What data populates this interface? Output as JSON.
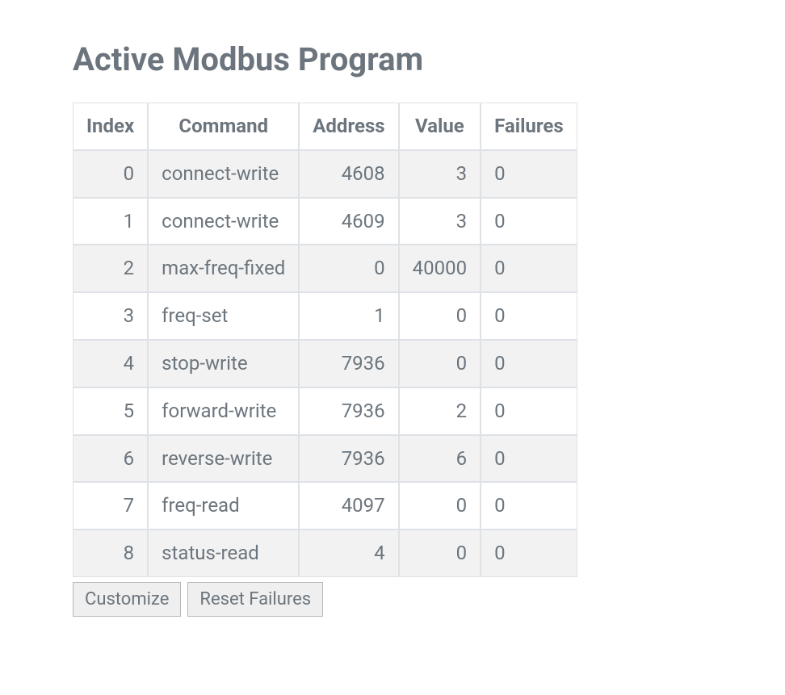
{
  "title": "Active Modbus Program",
  "columns": [
    "Index",
    "Command",
    "Address",
    "Value",
    "Failures"
  ],
  "rows": [
    {
      "index": "0",
      "command": "connect-write",
      "address": "4608",
      "value": "3",
      "failures": "0"
    },
    {
      "index": "1",
      "command": "connect-write",
      "address": "4609",
      "value": "3",
      "failures": "0"
    },
    {
      "index": "2",
      "command": "max-freq-fixed",
      "address": "0",
      "value": "40000",
      "failures": "0"
    },
    {
      "index": "3",
      "command": "freq-set",
      "address": "1",
      "value": "0",
      "failures": "0"
    },
    {
      "index": "4",
      "command": "stop-write",
      "address": "7936",
      "value": "0",
      "failures": "0"
    },
    {
      "index": "5",
      "command": "forward-write",
      "address": "7936",
      "value": "2",
      "failures": "0"
    },
    {
      "index": "6",
      "command": "reverse-write",
      "address": "7936",
      "value": "6",
      "failures": "0"
    },
    {
      "index": "7",
      "command": "freq-read",
      "address": "4097",
      "value": "0",
      "failures": "0"
    },
    {
      "index": "8",
      "command": "status-read",
      "address": "4",
      "value": "0",
      "failures": "0"
    }
  ],
  "buttons": {
    "customize": "Customize",
    "reset_failures": "Reset Failures"
  }
}
